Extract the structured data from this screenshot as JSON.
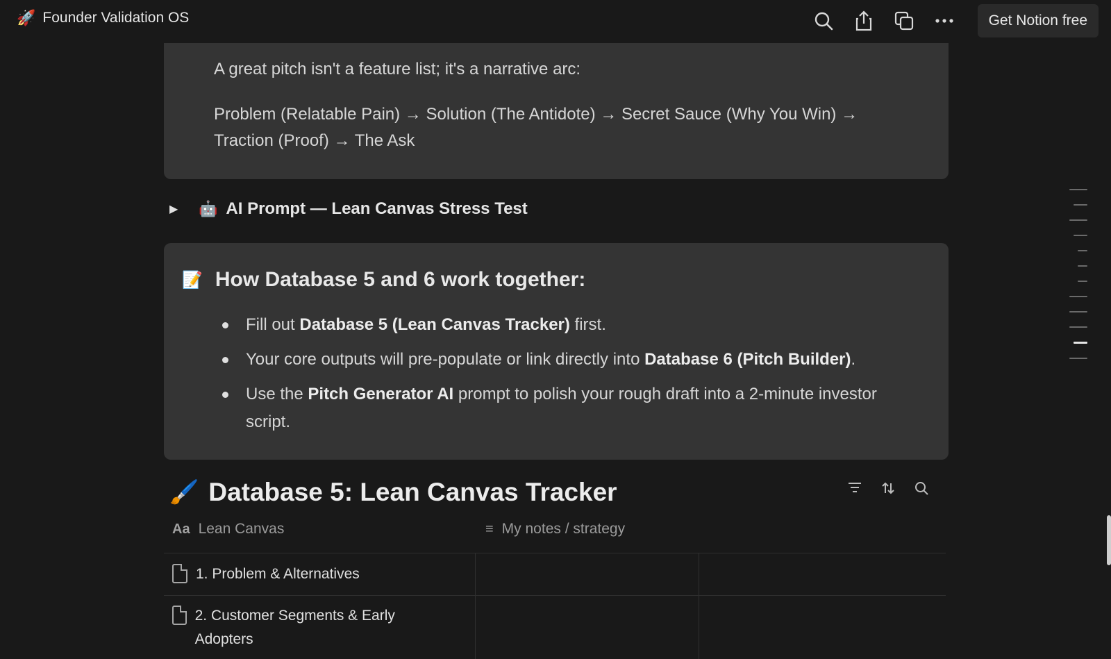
{
  "app": {
    "title": "Founder Validation OS",
    "emoji": "🚀",
    "actions": {
      "search_icon": "search-icon",
      "share_icon": "share-icon",
      "duplicate_icon": "duplicate-icon",
      "more_icon": "more-icon",
      "cta_label": "Get Notion free"
    }
  },
  "callout_pitch": {
    "line1": "A great pitch isn't a feature list; it's a narrative arc:",
    "line2": "Problem (Relatable Pain) → Solution (The Antidote) → Secret Sauce (Why You Win) → Traction (Proof) → The Ask"
  },
  "toggle": {
    "emoji": "🤖",
    "label": "AI Prompt — Lean Canvas Stress Test"
  },
  "callout_db": {
    "emoji": "📝",
    "heading": "How Database 5 and 6 work together:",
    "bullets": [
      {
        "pre": "Fill out ",
        "bold": "Database 5 (Lean Canvas Tracker)",
        "post": " first."
      },
      {
        "pre": "Your core outputs will pre-populate or link directly into ",
        "bold": "Database 6 (Pitch Builder)",
        "post": "."
      },
      {
        "pre": "Use the ",
        "bold": "Pitch Generator AI",
        "post": " prompt to polish your rough draft into a 2-minute investor script."
      }
    ]
  },
  "database": {
    "emoji": "🖌️",
    "title": "Database 5: Lean Canvas Tracker",
    "columns": [
      {
        "icon": "Aa",
        "label": "Lean Canvas"
      },
      {
        "icon": "≡",
        "label": "My notes / strategy"
      }
    ],
    "rows": [
      {
        "label": "1. Problem & Alternatives"
      },
      {
        "label": "2. Customer Segments & Early Adopters"
      }
    ]
  }
}
